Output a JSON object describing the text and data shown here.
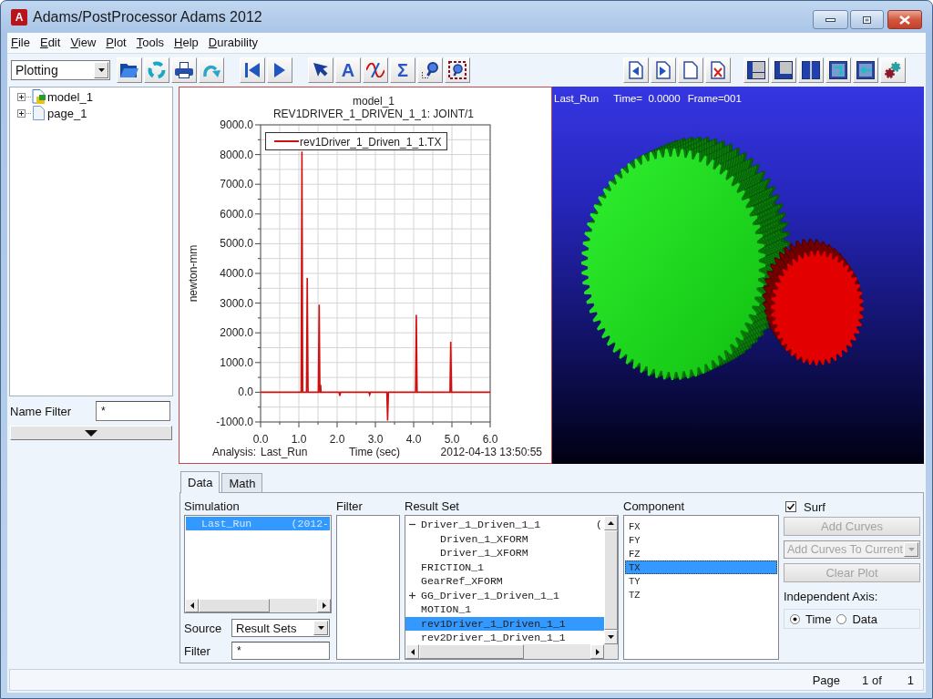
{
  "window": {
    "icon_letter": "A",
    "title": "Adams/PostProcessor Adams 2012"
  },
  "menu": [
    "File",
    "Edit",
    "View",
    "Plot",
    "Tools",
    "Help",
    "Durability"
  ],
  "toolbar": {
    "mode": "Plotting",
    "text_tool": "A",
    "sum_tool": "Σ"
  },
  "tree": {
    "items": [
      {
        "label": "model_1",
        "kind": "model",
        "expanded": false
      },
      {
        "label": "page_1",
        "kind": "page",
        "expanded": false
      }
    ]
  },
  "name_filter": {
    "label": "Name Filter",
    "value": "*"
  },
  "plot": {
    "subtitle": "REV1DRIVER_1_DRIVEN_1_1: JOINT/1",
    "analysis_label": "Analysis:",
    "analysis": "Last_Run",
    "date": "2012-04-13 13:50:55",
    "chart_data": {
      "type": "line",
      "title": "model_1",
      "xlabel": "Time (sec)",
      "ylabel": "newton-mm",
      "grid": true,
      "x": [
        0,
        1.06,
        1.08,
        1.1,
        1.2,
        1.22,
        1.24,
        1.51,
        1.53,
        1.55,
        1.56,
        1.57,
        1.58,
        2.05,
        2.07,
        2.09,
        2.83,
        2.85,
        2.87,
        3.3,
        3.32,
        3.34,
        4.05,
        4.07,
        4.09,
        4.95,
        4.97,
        4.99,
        6.0
      ],
      "series": [
        {
          "name": "rev1Driver_1_Driven_1_1.TX",
          "color": "#d01010",
          "values": [
            0,
            0,
            8100,
            0,
            0,
            3850,
            0,
            0,
            2950,
            0,
            0,
            250,
            0,
            0,
            -120,
            0,
            0,
            -80,
            0,
            0,
            -950,
            0,
            0,
            2600,
            0,
            0,
            1700,
            0,
            0
          ]
        }
      ],
      "xlim": [
        0,
        6
      ],
      "ylim": [
        -1000,
        9000
      ],
      "xticks": [
        {
          "value": 0,
          "label": "0.0"
        },
        {
          "value": 1,
          "label": "1.0"
        },
        {
          "value": 2,
          "label": "2.0"
        },
        {
          "value": 3,
          "label": "3.0"
        },
        {
          "value": 4,
          "label": "4.0"
        },
        {
          "value": 5,
          "label": "5.0"
        },
        {
          "value": 6,
          "label": "6.0"
        }
      ],
      "yticks": [
        {
          "value": -1000,
          "label": "-1000.0"
        },
        {
          "value": 0,
          "label": "0.0"
        },
        {
          "value": 1000,
          "label": "1000.0"
        },
        {
          "value": 2000,
          "label": "2000.0"
        },
        {
          "value": 3000,
          "label": "3000.0"
        },
        {
          "value": 4000,
          "label": "4000.0"
        },
        {
          "value": 5000,
          "label": "5000.0"
        },
        {
          "value": 6000,
          "label": "6000.0"
        },
        {
          "value": 7000,
          "label": "7000.0"
        },
        {
          "value": 8000,
          "label": "8000.0"
        },
        {
          "value": 9000,
          "label": "9000.0"
        }
      ]
    }
  },
  "viewport": {
    "run": "Last_Run",
    "time": "Time=  0.0000",
    "frame": "Frame=001"
  },
  "tabs": [
    {
      "label": "Data",
      "selected": true
    },
    {
      "label": "Math",
      "selected": false
    }
  ],
  "data_panel": {
    "simulation": {
      "label": "Simulation",
      "items": [
        {
          "name": "Last_Run",
          "detail": "(2012-",
          "selected": true
        }
      ]
    },
    "source": {
      "label": "Source",
      "value": "Result Sets"
    },
    "filter": {
      "label": "Filter",
      "value": "*"
    },
    "filter_list": {
      "label": "Filter"
    },
    "result_set": {
      "label": "Result Set",
      "items": [
        {
          "label": "Driver_1_Driven_1_1",
          "detail": "(",
          "kind": "group",
          "expanded": true,
          "selected": false,
          "children": [
            {
              "label": "Driven_1_XFORM",
              "selected": false
            },
            {
              "label": "Driver_1_XFORM",
              "selected": false
            }
          ]
        },
        {
          "label": "FRICTION_1",
          "kind": "item",
          "selected": false
        },
        {
          "label": "GearRef_XFORM",
          "kind": "item",
          "selected": false
        },
        {
          "label": "GG_Driver_1_Driven_1_1",
          "kind": "group",
          "expanded": false,
          "selected": false
        },
        {
          "label": "MOTION_1",
          "kind": "item",
          "selected": false
        },
        {
          "label": "rev1Driver_1_Driven_1_1",
          "kind": "item",
          "selected": true
        },
        {
          "label": "rev2Driver_1_Driven_1_1",
          "kind": "item",
          "selected": false
        }
      ]
    },
    "component": {
      "label": "Component",
      "items": [
        {
          "label": "FX",
          "selected": false
        },
        {
          "label": "FY",
          "selected": false
        },
        {
          "label": "FZ",
          "selected": false
        },
        {
          "label": "TX",
          "selected": true
        },
        {
          "label": "TY",
          "selected": false
        },
        {
          "label": "TZ",
          "selected": false
        }
      ]
    },
    "surf": {
      "label": "Surf",
      "checked": true
    },
    "buttons": [
      {
        "label": "Add Curves",
        "kind": "button",
        "disabled": true
      },
      {
        "label": "Add Curves To Current",
        "kind": "dropdown",
        "disabled": true
      },
      {
        "label": "Clear Plot",
        "kind": "button",
        "disabled": true
      }
    ],
    "independent_axis": {
      "label": "Independent Axis:",
      "options": [
        {
          "label": "Time",
          "selected": true
        },
        {
          "label": "Data",
          "selected": false
        }
      ]
    }
  },
  "status_bar": {
    "page_label": "Page",
    "page": "1 of",
    "total": "1"
  }
}
